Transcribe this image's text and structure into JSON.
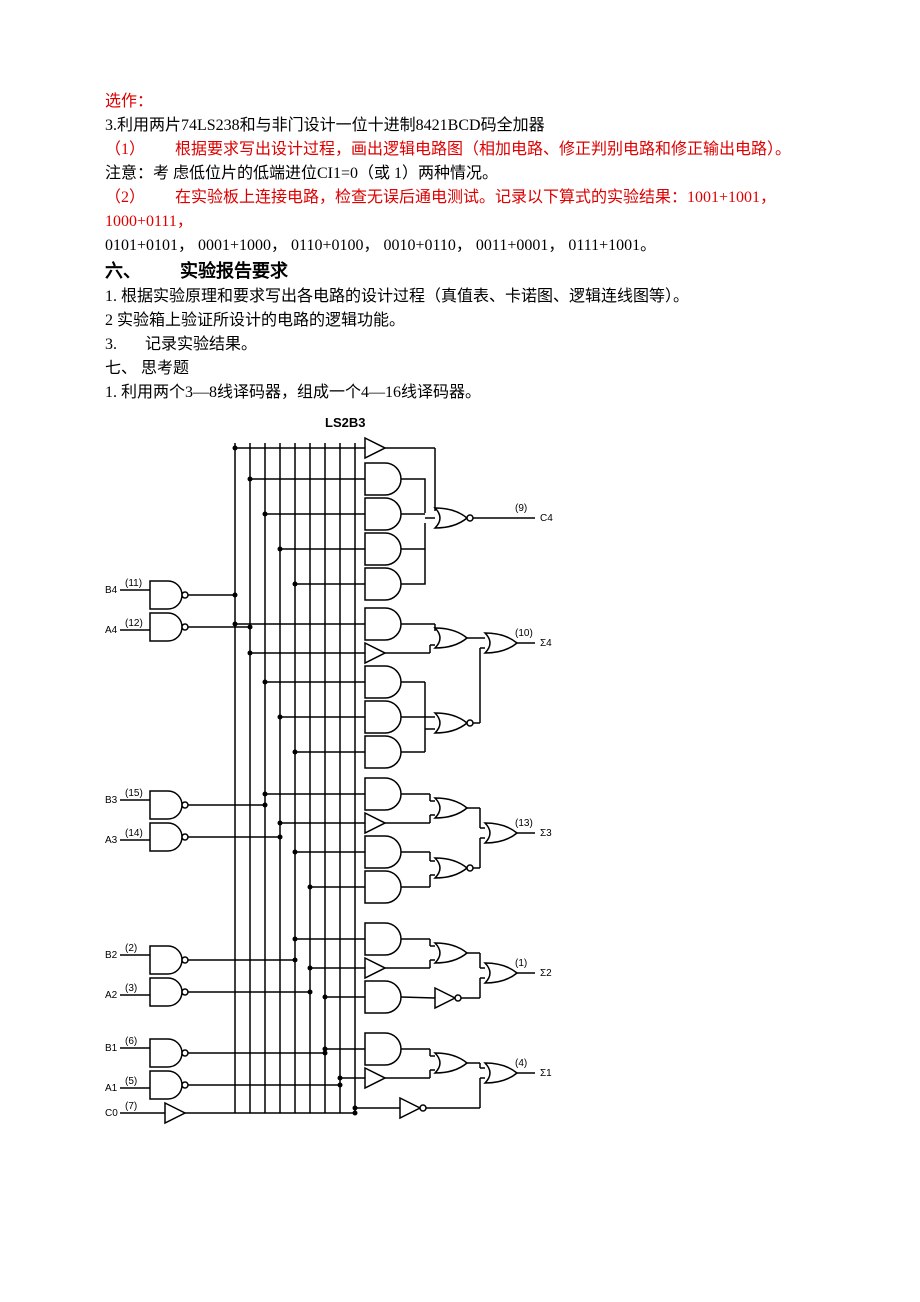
{
  "optional_header": "选作：",
  "item3": "3.利用两片74LS238和与非门设计一位十进制8421BCD码全加器",
  "item3_1_label": "（1）",
  "item3_1_text": "根据要求写出设计过程，画出逻辑电路图（相加电路、修正判别电路和修正输出电路）。",
  "note": "注意：考 虑低位片的低端进位CI1=0（或 1）两种情况。",
  "item3_2_label": "（2）",
  "item3_2_text": "在实验板上连接电路，检查无误后通电测试。记录以下算式的实验结果：1001+1001，",
  "item3_2_cont": "1000+0111，",
  "additions": "0101+0101， 0001+1000， 0110+0100， 0010+0110， 0011+0001， 0111+1001。",
  "sec6_num": "六、",
  "sec6_title": "实验报告要求",
  "sec6_1": "1. 根据实验原理和要求写出各电路的设计过程（真值表、卡诺图、逻辑连线图等）。",
  "sec6_2": "2 实验箱上验证所设计的电路的逻辑功能。",
  "sec6_3_num": "3.",
  "sec6_3_text": "记录实验结果。",
  "sec7": "七、 思考题",
  "sec7_1": "1. 利用两个3—8线译码器，组成一个4—16线译码器。",
  "diagram_title": "LS2B3",
  "pins": {
    "B4": {
      "label": "B4",
      "pin": "(11)"
    },
    "A4": {
      "label": "A4",
      "pin": "(12)"
    },
    "B3": {
      "label": "B3",
      "pin": "(15)"
    },
    "A3": {
      "label": "A3",
      "pin": "(14)"
    },
    "B2": {
      "label": "B2",
      "pin": "(2)"
    },
    "A2": {
      "label": "A2",
      "pin": "(3)"
    },
    "B1": {
      "label": "B1",
      "pin": "(6)"
    },
    "A1": {
      "label": "A1",
      "pin": "(5)"
    },
    "C0": {
      "label": "C0",
      "pin": "(7)"
    },
    "C4": {
      "label": "C4",
      "pin": "(9)"
    },
    "S4": {
      "label": "Σ4",
      "pin": "(10)"
    },
    "S3": {
      "label": "Σ3",
      "pin": "(13)"
    },
    "S2": {
      "label": "Σ2",
      "pin": "(1)"
    },
    "S1": {
      "label": "Σ1",
      "pin": "(4)"
    }
  }
}
